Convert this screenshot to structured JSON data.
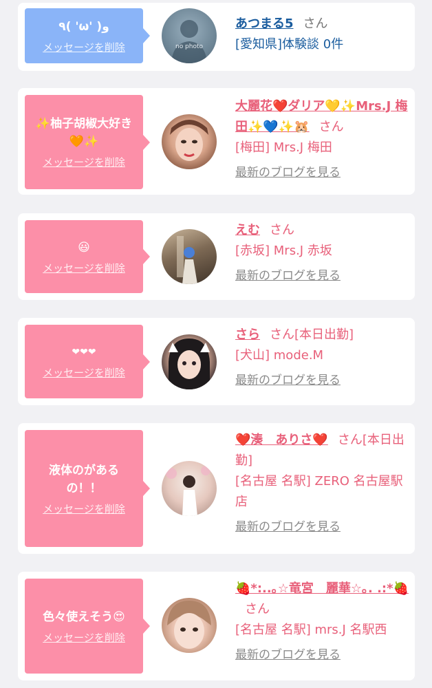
{
  "messages": [
    {
      "bubble_color": "#8ab4f8",
      "message": "٩( 'ω' )و",
      "delete_label": "メッセージを削除",
      "avatar_text": "no photo",
      "name": "あつまる5",
      "honorific": "さん",
      "detail": "[愛知県]体験談 0件",
      "blog_link": ""
    },
    {
      "bubble_color": "#fc8fa8",
      "message": "✨柚子胡椒大好き🧡✨",
      "delete_label": "メッセージを削除",
      "name": "大麗花❤️ダリア💛✨Mrs.J 梅田✨💙✨🐹",
      "honorific": "さん",
      "detail": "[梅田] Mrs.J 梅田",
      "blog_link": "最新のブログを見る"
    },
    {
      "bubble_color": "#fc8fa8",
      "message": "😃",
      "delete_label": "メッセージを削除",
      "name": "えむ",
      "honorific": "さん",
      "detail": "[赤坂] Mrs.J 赤坂",
      "blog_link": "最新のブログを見る"
    },
    {
      "bubble_color": "#fc8fa8",
      "message": "❤❤❤",
      "delete_label": "メッセージを削除",
      "name": "さら",
      "honorific": "さん[本日出勤]",
      "detail": "[犬山] mode.M",
      "blog_link": "最新のブログを見る"
    },
    {
      "bubble_color": "#fc8fa8",
      "message": "液体のがあるの！！",
      "delete_label": "メッセージを削除",
      "name": "❤️湊　ありさ❤️",
      "honorific": "さん[本日出勤]",
      "detail": "[名古屋 名駅] ZERO 名古屋駅店",
      "blog_link": "最新のブログを見る"
    },
    {
      "bubble_color": "#fc8fa8",
      "message": "色々使えそう😍",
      "delete_label": "メッセージを削除",
      "name": "🍓*:..｡☆竜宮　麗華☆｡. .:*🍓",
      "honorific": "さん",
      "detail": "[名古屋 名駅] mrs.J 名駅西",
      "blog_link": "最新のブログを見る"
    }
  ]
}
